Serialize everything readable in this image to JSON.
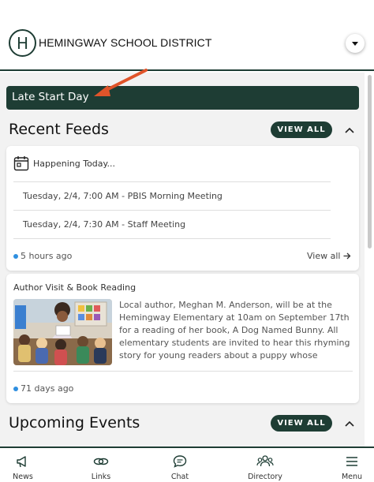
{
  "header": {
    "logo_letter": "H",
    "district_name": "HEMINGWAY SCHOOL DISTRICT"
  },
  "alert": {
    "text": "Late Start Day"
  },
  "recent_feeds": {
    "title": "Recent Feeds",
    "view_all": "VIEW ALL",
    "happening": {
      "heading": "Happening Today...",
      "events": [
        "Tuesday, 2/4, 7:00 AM - PBIS Morning Meeting",
        "Tuesday, 2/4, 7:30 AM - Staff Meeting"
      ],
      "time_ago": "5 hours ago",
      "view_all_link": "View all"
    },
    "post": {
      "title": "Author Visit & Book Reading",
      "body": "Local author, Meghan M. Anderson, will be at the Hemingway Elementary at 10am on September 17th for a reading of her book, A Dog Named Bunny. All elementary students are invited to hear this rhyming story for young readers about a puppy whose parents decided to nam...",
      "time_ago": "71 days ago"
    }
  },
  "upcoming_events": {
    "title": "Upcoming Events",
    "view_all": "VIEW ALL"
  },
  "nav": {
    "items": [
      "News",
      "Links",
      "Chat",
      "Directory",
      "Menu"
    ]
  },
  "colors": {
    "brand": "#1e3d34",
    "dot": "#2f8fe0",
    "arrow": "#e0542a"
  },
  "icons": [
    "calendar-icon",
    "megaphone-icon",
    "links-icon",
    "chat-icon",
    "directory-icon",
    "menu-icon",
    "chevron-up-icon",
    "chevron-down-icon",
    "arrow-right-icon"
  ]
}
